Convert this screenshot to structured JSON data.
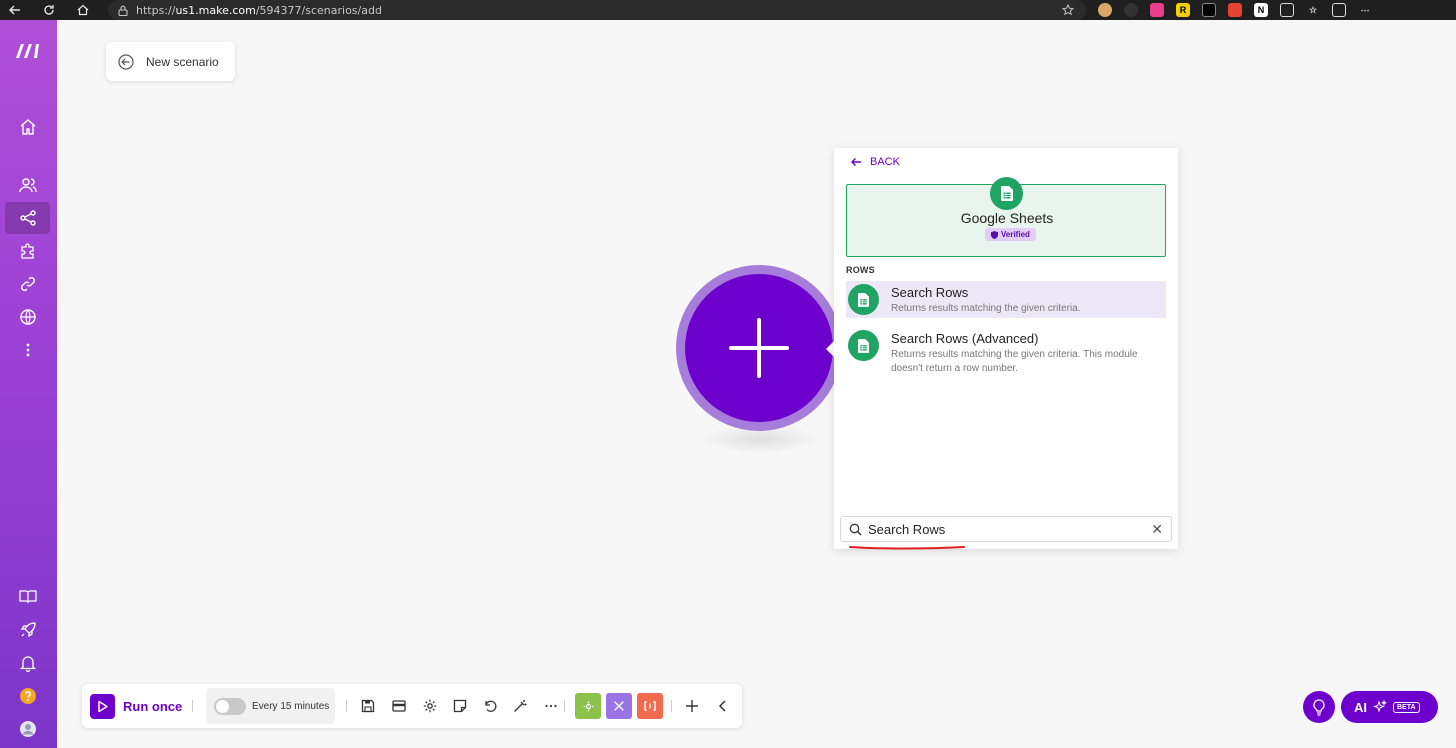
{
  "browser": {
    "url_prefix": "https://",
    "url_host": "us1.make.com",
    "url_path": "/594377/scenarios/add"
  },
  "header": {
    "scenario_title": "New scenario"
  },
  "panel": {
    "back_label": "BACK",
    "app_name": "Google Sheets",
    "verified_label": "Verified",
    "section_label": "ROWS",
    "modules": [
      {
        "title": "Search Rows",
        "description": "Returns results matching the given criteria."
      },
      {
        "title": "Search Rows (Advanced)",
        "description": "Returns results matching the given criteria. This module doesn't return a row number."
      }
    ],
    "search_value": "Search Rows"
  },
  "toolbar": {
    "run_label": "Run once",
    "schedule_label": "Every 15 minutes"
  },
  "ai": {
    "label": "AI",
    "beta_label": "BETA"
  },
  "colors": {
    "brand_purple": "#6d00cc",
    "sheets_green": "#1fa463",
    "sidebar_top": "#b04fd8",
    "sidebar_bottom": "#7d35c9"
  }
}
